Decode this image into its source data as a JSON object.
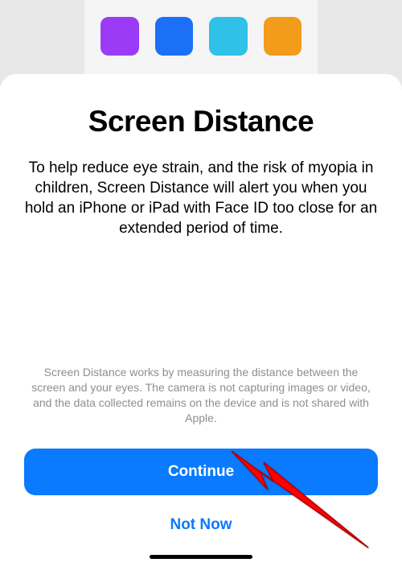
{
  "backgroundIcons": [
    {
      "semantic": "app-icon-purple"
    },
    {
      "semantic": "app-icon-blue"
    },
    {
      "semantic": "app-icon-cyan"
    },
    {
      "semantic": "app-icon-orange"
    }
  ],
  "sheet": {
    "title": "Screen Distance",
    "description": "To help reduce eye strain, and the risk of myopia in children, Screen Distance will alert you when you hold an iPhone or iPad with Face ID too close for an extended period of time.",
    "finePrint": "Screen Distance works by measuring the distance between the screen and your eyes. The camera is not capturing images or video, and the data collected remains on the device and is not shared with Apple.",
    "continueLabel": "Continue",
    "notNowLabel": "Not Now"
  }
}
